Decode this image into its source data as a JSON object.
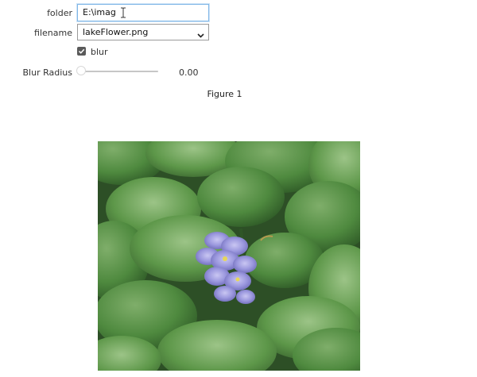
{
  "folder": {
    "label": "folder",
    "value": "E:\\imag"
  },
  "filename": {
    "label": "filename",
    "selected": "lakeFlower.png"
  },
  "blur": {
    "label": "blur",
    "checked": true
  },
  "blur_radius": {
    "label": "Blur Radius",
    "value_text": "0.00",
    "value": 0.0
  },
  "figure": {
    "title": "Figure 1",
    "image_subject": "water hyacinth flower among green leaves"
  },
  "colors": {
    "focus_border": "#7fb6e6",
    "checkbox_fill": "#5a5a5a",
    "leaf_green": "#4f8a3f",
    "flower_purple": "#8f8fd6"
  }
}
